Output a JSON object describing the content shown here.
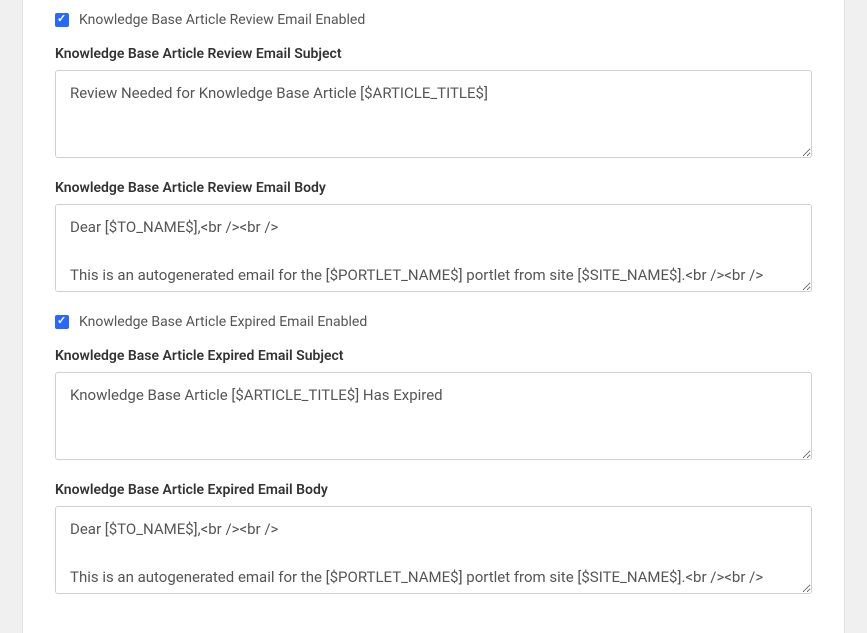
{
  "reviewSection": {
    "enabledLabel": "Knowledge Base Article Review Email Enabled",
    "enabledChecked": true,
    "subjectLabel": "Knowledge Base Article Review Email Subject",
    "subjectValue": "Review Needed for Knowledge Base Article [$ARTICLE_TITLE$]",
    "bodyLabel": "Knowledge Base Article Review Email Body",
    "bodyValue": "Dear [$TO_NAME$],<br /><br />\n\nThis is an autogenerated email for the [$PORTLET_NAME$] portlet from site [$SITE_NAME$].<br /><br />"
  },
  "expiredSection": {
    "enabledLabel": "Knowledge Base Article Expired Email Enabled",
    "enabledChecked": true,
    "subjectLabel": "Knowledge Base Article Expired Email Subject",
    "subjectValue": "Knowledge Base Article [$ARTICLE_TITLE$] Has Expired",
    "bodyLabel": "Knowledge Base Article Expired Email Body",
    "bodyValue": "Dear [$TO_NAME$],<br /><br />\n\nThis is an autogenerated email for the [$PORTLET_NAME$] portlet from site [$SITE_NAME$].<br /><br />"
  }
}
